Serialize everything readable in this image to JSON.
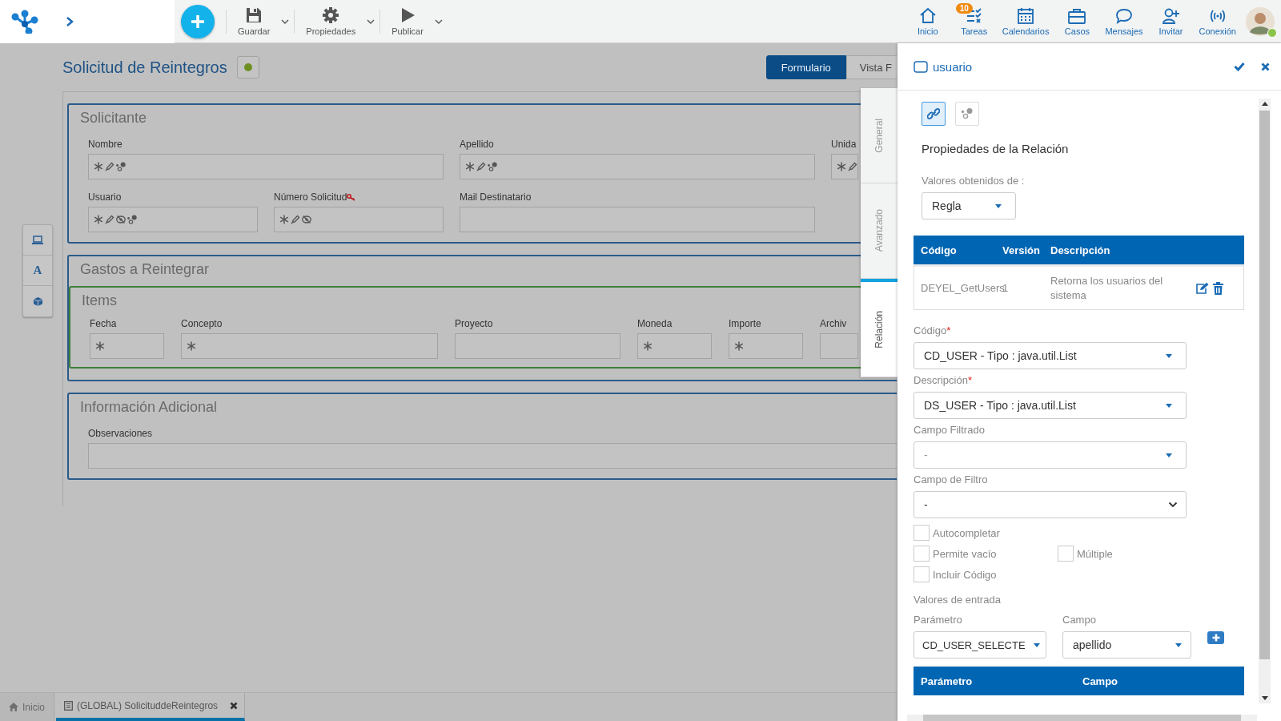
{
  "app_bar": {
    "toolbar": [
      {
        "label": "Guardar"
      },
      {
        "label": "Propiedades"
      },
      {
        "label": "Publicar"
      }
    ],
    "nav": [
      {
        "label": "Inicio"
      },
      {
        "label": "Tareas",
        "badge": "10"
      },
      {
        "label": "Calendarios"
      },
      {
        "label": "Casos"
      },
      {
        "label": "Mensajes"
      },
      {
        "label": "Invitar"
      },
      {
        "label": "Conexión"
      }
    ],
    "user": {
      "online": true
    }
  },
  "tool_palette": {
    "letter": "A"
  },
  "page": {
    "title": "Solicitud de Reintegros",
    "view_tabs": [
      {
        "label": "Formulario",
        "selected": true
      },
      {
        "label": "Vista F",
        "selected": false
      }
    ]
  },
  "sections": [
    {
      "title": "Solicitante",
      "kind": "plain",
      "fields": [
        {
          "label": "Nombre",
          "required": true,
          "editable": true,
          "relation": true,
          "hidden": false,
          "key": false
        },
        {
          "label": "Apellido",
          "required": true,
          "editable": true,
          "relation": true,
          "hidden": false,
          "key": false
        },
        {
          "label": "Unida",
          "required": true,
          "editable": true,
          "relation": false,
          "hidden": false,
          "key": false
        },
        {
          "label": "Usuario",
          "required": true,
          "editable": true,
          "relation": true,
          "hidden": true,
          "key": false
        },
        {
          "label": "Número Solicitud",
          "required": true,
          "editable": true,
          "relation": false,
          "hidden": true,
          "key": true
        },
        {
          "label": "Mail Destinatario",
          "required": false,
          "editable": false,
          "relation": false,
          "hidden": false,
          "key": false
        }
      ]
    },
    {
      "title": "Gastos a Reintegrar",
      "kind": "group",
      "subsections": [
        {
          "title": "Items",
          "fields": [
            {
              "label": "Fecha",
              "required": true,
              "editable": false,
              "relation": false,
              "hidden": false,
              "key": false
            },
            {
              "label": "Concepto",
              "required": true,
              "editable": false,
              "relation": false,
              "hidden": false,
              "key": false
            },
            {
              "label": "Proyecto",
              "required": false,
              "editable": false,
              "relation": false,
              "hidden": false,
              "key": false
            },
            {
              "label": "Moneda",
              "required": true,
              "editable": false,
              "relation": false,
              "hidden": false,
              "key": false
            },
            {
              "label": "Importe",
              "required": true,
              "editable": false,
              "relation": false,
              "hidden": false,
              "key": false
            },
            {
              "label": "Archiv",
              "required": false,
              "editable": false,
              "relation": false,
              "hidden": false,
              "key": false
            }
          ]
        }
      ]
    },
    {
      "title": "Información Adicional",
      "kind": "plain",
      "fields": [
        {
          "label": "Observaciones",
          "required": false,
          "editable": false,
          "relation": false,
          "hidden": false,
          "key": false
        }
      ]
    }
  ],
  "side_tabs": [
    {
      "label": "General",
      "selected": false
    },
    {
      "label": "Avanzado",
      "selected": false
    },
    {
      "label": "Relación",
      "selected": true
    }
  ],
  "panel": {
    "title": "usuario",
    "mode_buttons": [
      {
        "selected": true
      },
      {
        "selected": false
      }
    ],
    "heading": "Propiedades de la Relación",
    "source": {
      "label": "Valores obtenidos de :",
      "value": "Regla"
    },
    "rules_table": {
      "columns": [
        "Código",
        "Versión",
        "Descripción"
      ],
      "rows": [
        {
          "cells": [
            "DEYEL_GetUsers",
            "1",
            "Retorna los usuarios del sistema"
          ]
        }
      ]
    },
    "fields": [
      {
        "label": "Código",
        "required_mark": "*",
        "value": "CD_USER - Tipo : java.util.List",
        "kind": "select"
      },
      {
        "label": "Descripción",
        "required_mark": "*",
        "value": "DS_USER - Tipo : java.util.List",
        "kind": "select"
      },
      {
        "label": "Campo Filtrado",
        "placeholder": "-",
        "kind": "select"
      },
      {
        "label": "Campo de Filtro",
        "value": "-",
        "kind": "native"
      }
    ],
    "checkbox_rows": [
      {
        "items": [
          {
            "label": "Autocompletar",
            "checked": false
          }
        ]
      },
      {
        "items": [
          {
            "label": "Permite vacío",
            "checked": false
          },
          {
            "label": "Múltiple",
            "checked": false
          }
        ]
      },
      {
        "items": [
          {
            "label": "Incluir Código",
            "checked": false
          }
        ]
      }
    ],
    "inputs": {
      "label": "Valores de entrada",
      "parameter": {
        "label": "Parámetro",
        "value": "CD_USER_SELECTE"
      },
      "field": {
        "label": "Campo",
        "value": "apellido"
      }
    },
    "mapping_table": {
      "columns": [
        "Parámetro",
        "Campo"
      ]
    }
  },
  "bottom_tabs": [
    {
      "label": "Inicio",
      "selected": false,
      "closable": false
    },
    {
      "label": "(GLOBAL) SolicituddeReintegros",
      "selected": true,
      "closable": true
    }
  ]
}
